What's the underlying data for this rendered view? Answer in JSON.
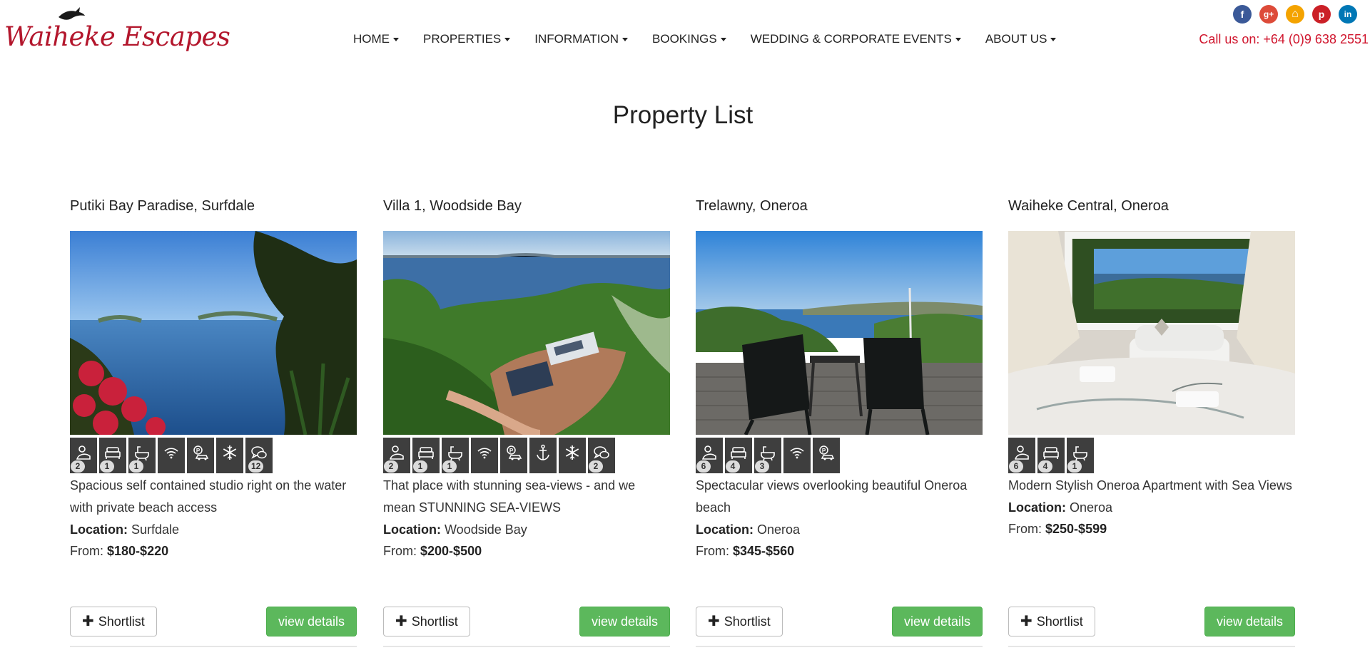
{
  "header": {
    "logo_text": "Waiheke Escapes",
    "phone": "Call us on: +64 (0)9 638 2551",
    "nav": [
      {
        "label": "HOME"
      },
      {
        "label": "PROPERTIES"
      },
      {
        "label": "INFORMATION"
      },
      {
        "label": "BOOKINGS"
      },
      {
        "label": "WEDDING & CORPORATE EVENTS"
      },
      {
        "label": "ABOUT US"
      }
    ],
    "socials": [
      {
        "icon": "facebook-icon",
        "glyph": "f",
        "color": "#3b5998"
      },
      {
        "icon": "google-plus-icon",
        "glyph": "g+",
        "color": "#dd4b39"
      },
      {
        "icon": "home-icon",
        "glyph": "⌂",
        "color": "#f4a300"
      },
      {
        "icon": "pinterest-icon",
        "glyph": "p",
        "color": "#cb2027"
      },
      {
        "icon": "linkedin-icon",
        "glyph": "in",
        "color": "#0077b5"
      }
    ]
  },
  "page": {
    "title": "Property List"
  },
  "properties": [
    {
      "name": "Putiki Bay Paradise, Surfdale",
      "description": "Spacious self contained studio right on the water with private beach access",
      "location_label": "Location:",
      "location": "Surfdale",
      "from_label": "From:",
      "price": "$180-$220",
      "amenities": [
        {
          "icon": "bedroom-icon",
          "count": "2"
        },
        {
          "icon": "bed-icon",
          "count": "1"
        },
        {
          "icon": "bathroom-icon",
          "count": "1"
        },
        {
          "icon": "wifi-icon",
          "count": ""
        },
        {
          "icon": "parking-icon",
          "count": ""
        },
        {
          "icon": "air-conditioning-icon",
          "count": ""
        },
        {
          "icon": "reviews-icon",
          "count": "12"
        }
      ]
    },
    {
      "name": "Villa 1, Woodside Bay",
      "description": "That place with stunning sea-views - and we mean STUNNING SEA-VIEWS",
      "location_label": "Location:",
      "location": "Woodside Bay",
      "from_label": "From:",
      "price": "$200-$500",
      "amenities": [
        {
          "icon": "bedroom-icon",
          "count": "2"
        },
        {
          "icon": "bed-icon",
          "count": "1"
        },
        {
          "icon": "bathroom-icon",
          "count": "1"
        },
        {
          "icon": "wifi-icon",
          "count": ""
        },
        {
          "icon": "parking-icon",
          "count": ""
        },
        {
          "icon": "anchor-icon",
          "count": ""
        },
        {
          "icon": "air-conditioning-icon",
          "count": ""
        },
        {
          "icon": "reviews-icon",
          "count": "2"
        }
      ]
    },
    {
      "name": "Trelawny, Oneroa",
      "description": "Spectacular views overlooking beautiful Oneroa beach",
      "location_label": "Location:",
      "location": "Oneroa",
      "from_label": "From:",
      "price": "$345-$560",
      "amenities": [
        {
          "icon": "bedroom-icon",
          "count": "6"
        },
        {
          "icon": "bed-icon",
          "count": "4"
        },
        {
          "icon": "bathroom-icon",
          "count": "3"
        },
        {
          "icon": "wifi-icon",
          "count": ""
        },
        {
          "icon": "parking-icon",
          "count": ""
        }
      ]
    },
    {
      "name": "Waiheke Central, Oneroa",
      "description": "Modern Stylish Oneroa Apartment with Sea Views",
      "location_label": "Location:",
      "location": "Oneroa",
      "from_label": "From:",
      "price": "$250-$599",
      "amenities": [
        {
          "icon": "bedroom-icon",
          "count": "6"
        },
        {
          "icon": "bed-icon",
          "count": "4"
        },
        {
          "icon": "bathroom-icon",
          "count": "1"
        }
      ]
    }
  ],
  "buttons": {
    "shortlist": "Shortlist",
    "details": "view details"
  },
  "colors": {
    "brand": "#b3162c",
    "phone": "#d0152d",
    "details_button": "#5cb85c",
    "amenity_tile": "#3e3e3e"
  }
}
